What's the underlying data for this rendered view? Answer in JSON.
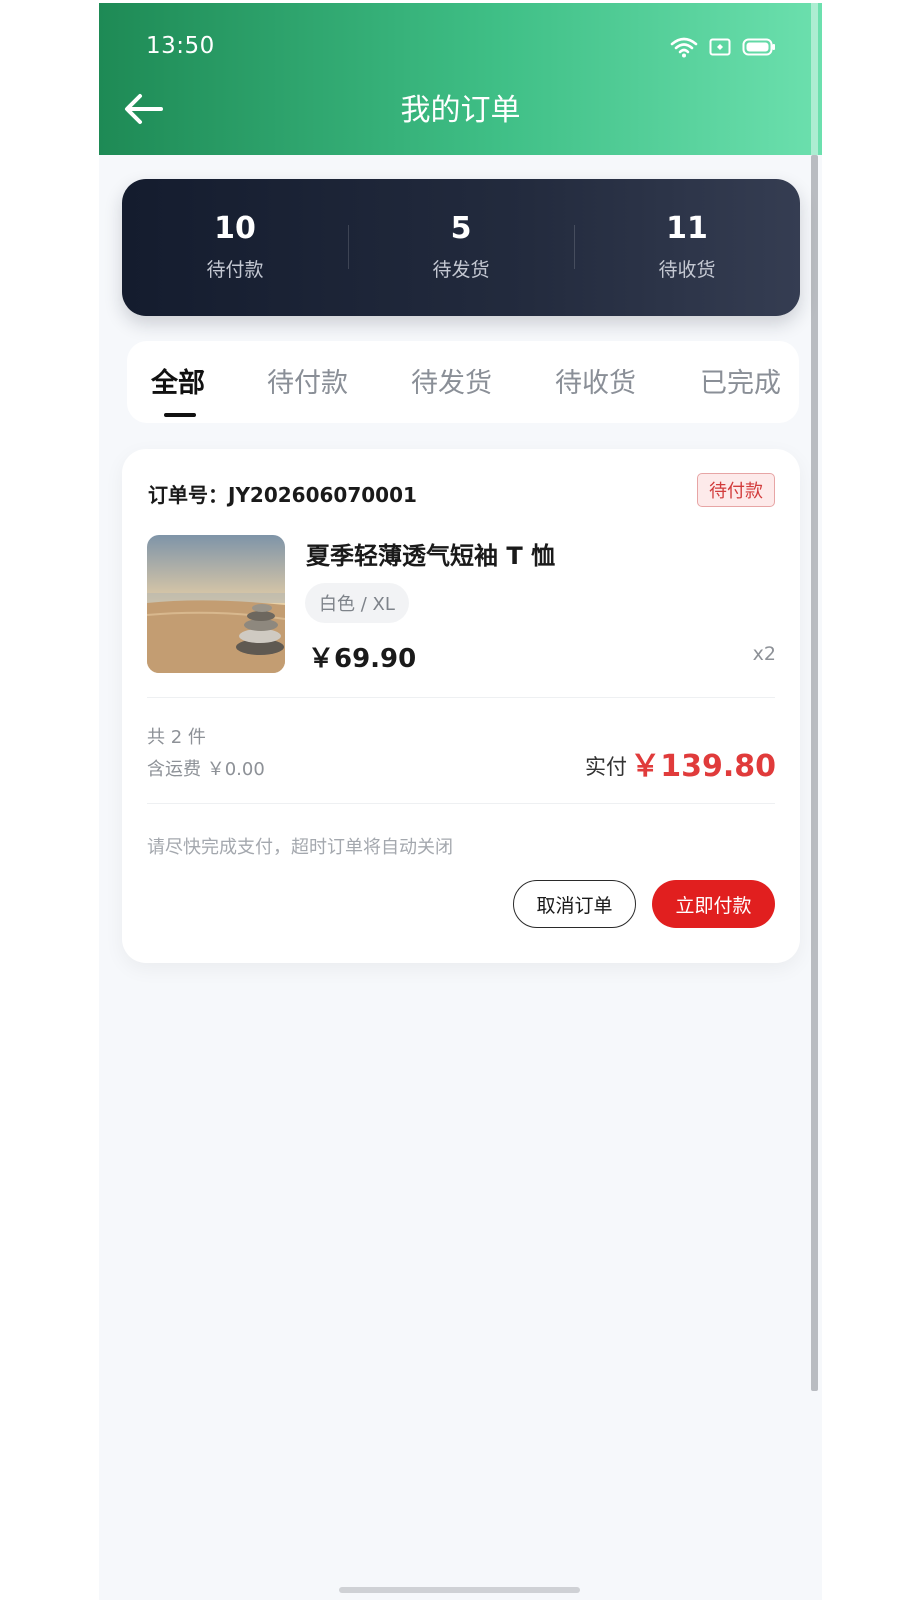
{
  "status_bar": {
    "time": "13:50"
  },
  "header": {
    "title": "我的订单"
  },
  "stats": [
    {
      "count": "10",
      "label": "待付款"
    },
    {
      "count": "5",
      "label": "待发货"
    },
    {
      "count": "11",
      "label": "待收货"
    }
  ],
  "tabs": [
    {
      "label": "全部",
      "active": true
    },
    {
      "label": "待付款",
      "active": false
    },
    {
      "label": "待发货",
      "active": false
    },
    {
      "label": "待收货",
      "active": false
    },
    {
      "label": "已完成",
      "active": false
    }
  ],
  "order": {
    "order_no": "订单号：JY202606070001",
    "status": "待付款",
    "product_name": "夏季轻薄透气短袖 T 恤",
    "sku": "白色 / XL",
    "price": "￥69.90",
    "qty": "x2",
    "item_count": "共 2 件",
    "shipping": "含运费 ￥0.00",
    "paid_label": "实付",
    "paid_amount": "￥139.80",
    "notice": "请尽快完成支付，超时订单将自动关闭",
    "cancel_label": "取消订单",
    "pay_label": "立即付款"
  },
  "colors": {
    "header_start": "#1e8a55",
    "header_end": "#6ce0ae",
    "stats_bg": "#141c2e",
    "accent_red": "#e11f1f"
  }
}
